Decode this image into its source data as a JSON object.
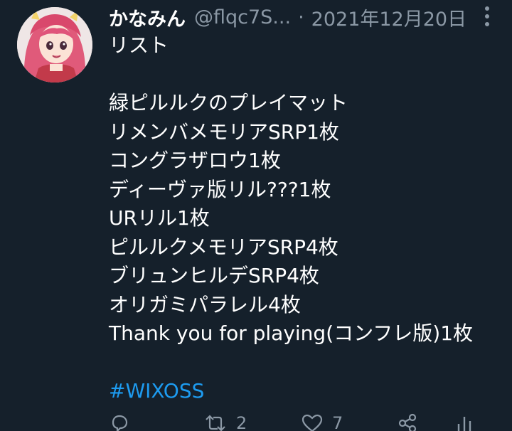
{
  "tweet": {
    "display_name": "かなみん",
    "handle": "@flqc7S...",
    "separator": "·",
    "date": "2021年12月20日",
    "lines": [
      "リスト",
      "",
      "緑ピルルクのプレイマット",
      "リメンバメモリアSRP1枚",
      "コングラザロウ1枚",
      "ディーヴァ版リル???1枚",
      "URリル1枚",
      "ピルルクメモリアSRP4枚",
      "ブリュンヒルデSRP4枚",
      "オリガミパラレル4枚",
      "Thank you for playing(コンフレ版)1枚",
      ""
    ],
    "hashtag": "#WIXOSS"
  },
  "actions": {
    "reply_icon": "reply-icon",
    "retweet_icon": "retweet-icon",
    "retweet_count": "2",
    "like_icon": "heart-icon",
    "like_count": "7",
    "share_icon": "share-icon",
    "analytics_icon": "analytics-icon"
  },
  "colors": {
    "background": "#15202b",
    "text": "#ffffff",
    "muted": "#8b98a5",
    "accent": "#1d9bf0"
  }
}
